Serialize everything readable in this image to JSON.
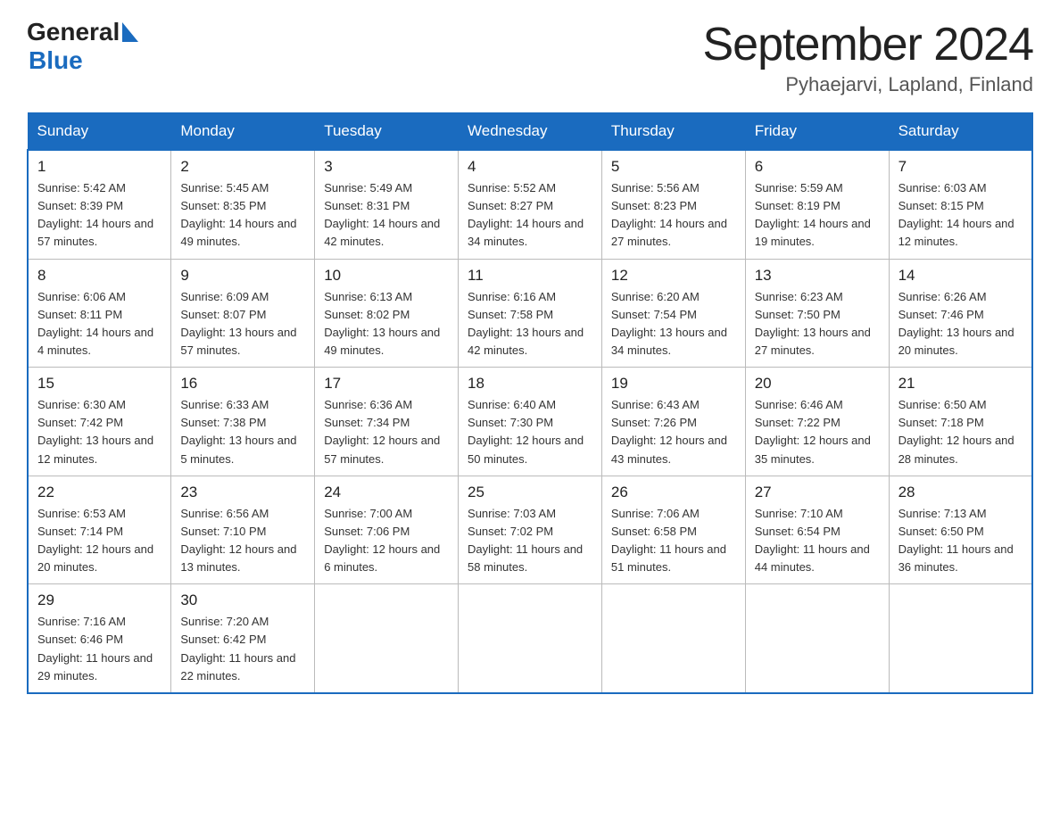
{
  "header": {
    "logo_general": "General",
    "logo_blue": "Blue",
    "title": "September 2024",
    "subtitle": "Pyhaejarvi, Lapland, Finland"
  },
  "calendar": {
    "weekdays": [
      "Sunday",
      "Monday",
      "Tuesday",
      "Wednesday",
      "Thursday",
      "Friday",
      "Saturday"
    ],
    "weeks": [
      [
        {
          "day": 1,
          "sunrise": "5:42 AM",
          "sunset": "8:39 PM",
          "daylight": "14 hours and 57 minutes."
        },
        {
          "day": 2,
          "sunrise": "5:45 AM",
          "sunset": "8:35 PM",
          "daylight": "14 hours and 49 minutes."
        },
        {
          "day": 3,
          "sunrise": "5:49 AM",
          "sunset": "8:31 PM",
          "daylight": "14 hours and 42 minutes."
        },
        {
          "day": 4,
          "sunrise": "5:52 AM",
          "sunset": "8:27 PM",
          "daylight": "14 hours and 34 minutes."
        },
        {
          "day": 5,
          "sunrise": "5:56 AM",
          "sunset": "8:23 PM",
          "daylight": "14 hours and 27 minutes."
        },
        {
          "day": 6,
          "sunrise": "5:59 AM",
          "sunset": "8:19 PM",
          "daylight": "14 hours and 19 minutes."
        },
        {
          "day": 7,
          "sunrise": "6:03 AM",
          "sunset": "8:15 PM",
          "daylight": "14 hours and 12 minutes."
        }
      ],
      [
        {
          "day": 8,
          "sunrise": "6:06 AM",
          "sunset": "8:11 PM",
          "daylight": "14 hours and 4 minutes."
        },
        {
          "day": 9,
          "sunrise": "6:09 AM",
          "sunset": "8:07 PM",
          "daylight": "13 hours and 57 minutes."
        },
        {
          "day": 10,
          "sunrise": "6:13 AM",
          "sunset": "8:02 PM",
          "daylight": "13 hours and 49 minutes."
        },
        {
          "day": 11,
          "sunrise": "6:16 AM",
          "sunset": "7:58 PM",
          "daylight": "13 hours and 42 minutes."
        },
        {
          "day": 12,
          "sunrise": "6:20 AM",
          "sunset": "7:54 PM",
          "daylight": "13 hours and 34 minutes."
        },
        {
          "day": 13,
          "sunrise": "6:23 AM",
          "sunset": "7:50 PM",
          "daylight": "13 hours and 27 minutes."
        },
        {
          "day": 14,
          "sunrise": "6:26 AM",
          "sunset": "7:46 PM",
          "daylight": "13 hours and 20 minutes."
        }
      ],
      [
        {
          "day": 15,
          "sunrise": "6:30 AM",
          "sunset": "7:42 PM",
          "daylight": "13 hours and 12 minutes."
        },
        {
          "day": 16,
          "sunrise": "6:33 AM",
          "sunset": "7:38 PM",
          "daylight": "13 hours and 5 minutes."
        },
        {
          "day": 17,
          "sunrise": "6:36 AM",
          "sunset": "7:34 PM",
          "daylight": "12 hours and 57 minutes."
        },
        {
          "day": 18,
          "sunrise": "6:40 AM",
          "sunset": "7:30 PM",
          "daylight": "12 hours and 50 minutes."
        },
        {
          "day": 19,
          "sunrise": "6:43 AM",
          "sunset": "7:26 PM",
          "daylight": "12 hours and 43 minutes."
        },
        {
          "day": 20,
          "sunrise": "6:46 AM",
          "sunset": "7:22 PM",
          "daylight": "12 hours and 35 minutes."
        },
        {
          "day": 21,
          "sunrise": "6:50 AM",
          "sunset": "7:18 PM",
          "daylight": "12 hours and 28 minutes."
        }
      ],
      [
        {
          "day": 22,
          "sunrise": "6:53 AM",
          "sunset": "7:14 PM",
          "daylight": "12 hours and 20 minutes."
        },
        {
          "day": 23,
          "sunrise": "6:56 AM",
          "sunset": "7:10 PM",
          "daylight": "12 hours and 13 minutes."
        },
        {
          "day": 24,
          "sunrise": "7:00 AM",
          "sunset": "7:06 PM",
          "daylight": "12 hours and 6 minutes."
        },
        {
          "day": 25,
          "sunrise": "7:03 AM",
          "sunset": "7:02 PM",
          "daylight": "11 hours and 58 minutes."
        },
        {
          "day": 26,
          "sunrise": "7:06 AM",
          "sunset": "6:58 PM",
          "daylight": "11 hours and 51 minutes."
        },
        {
          "day": 27,
          "sunrise": "7:10 AM",
          "sunset": "6:54 PM",
          "daylight": "11 hours and 44 minutes."
        },
        {
          "day": 28,
          "sunrise": "7:13 AM",
          "sunset": "6:50 PM",
          "daylight": "11 hours and 36 minutes."
        }
      ],
      [
        {
          "day": 29,
          "sunrise": "7:16 AM",
          "sunset": "6:46 PM",
          "daylight": "11 hours and 29 minutes."
        },
        {
          "day": 30,
          "sunrise": "7:20 AM",
          "sunset": "6:42 PM",
          "daylight": "11 hours and 22 minutes."
        },
        null,
        null,
        null,
        null,
        null
      ]
    ]
  }
}
